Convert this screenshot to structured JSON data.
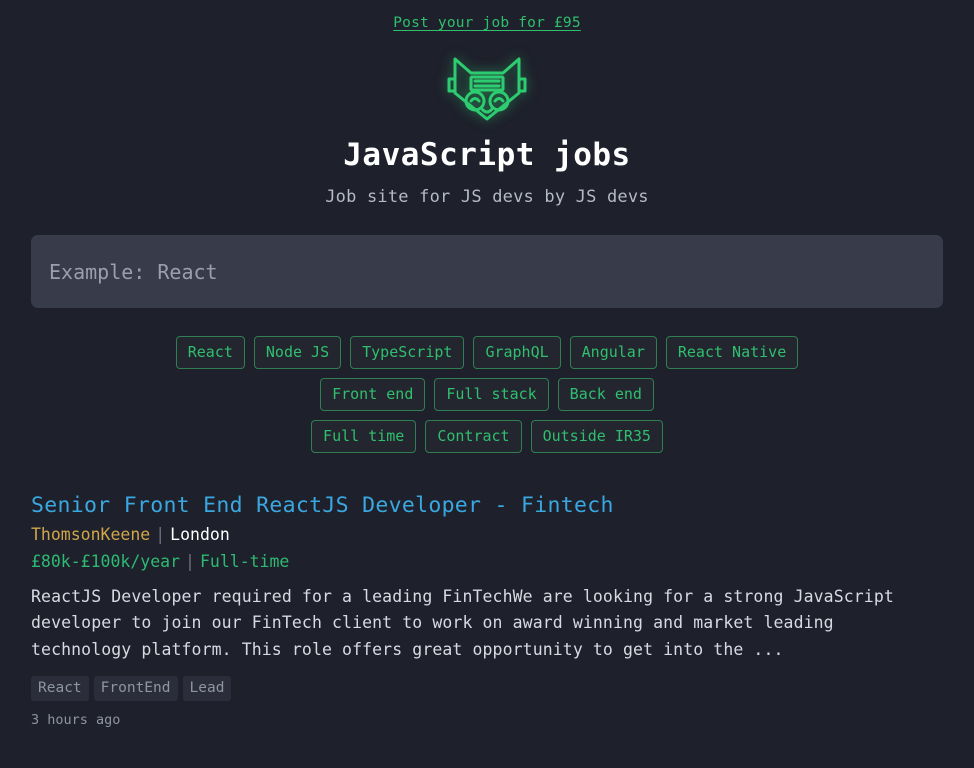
{
  "header": {
    "post_job_link": "Post your job for £95",
    "logo_icon": "robot-cat-logo-icon",
    "site_title": "JavaScript jobs",
    "site_subtitle": "Job site for JS devs by JS devs"
  },
  "search": {
    "value": "",
    "placeholder": "Example: React"
  },
  "filters": {
    "rows": [
      [
        "React",
        "Node JS",
        "TypeScript",
        "GraphQL",
        "Angular",
        "React Native"
      ],
      [
        "Front end",
        "Full stack",
        "Back end"
      ],
      [
        "Full time",
        "Contract",
        "Outside IR35"
      ]
    ]
  },
  "jobs": [
    {
      "title": "Senior Front End ReactJS Developer - Fintech",
      "company": "ThomsonKeene",
      "location": "London",
      "salary": "£80k-£100k/year",
      "contract_type": "Full-time",
      "separator": "|",
      "description": "ReactJS Developer required for a leading FinTechWe are looking for a strong JavaScript developer to join our FinTech client to work on award winning and market leading technology platform. This role offers great opportunity to get into the ...",
      "tags": [
        "React",
        "FrontEnd",
        "Lead"
      ],
      "posted": "3 hours ago"
    }
  ],
  "colors": {
    "background": "#1e202b",
    "accent_green": "#2fbf6e",
    "title_blue": "#3aa8e0",
    "company_gold": "#d1a64a",
    "input_bg": "#383b4a",
    "muted": "#8f94a3"
  }
}
